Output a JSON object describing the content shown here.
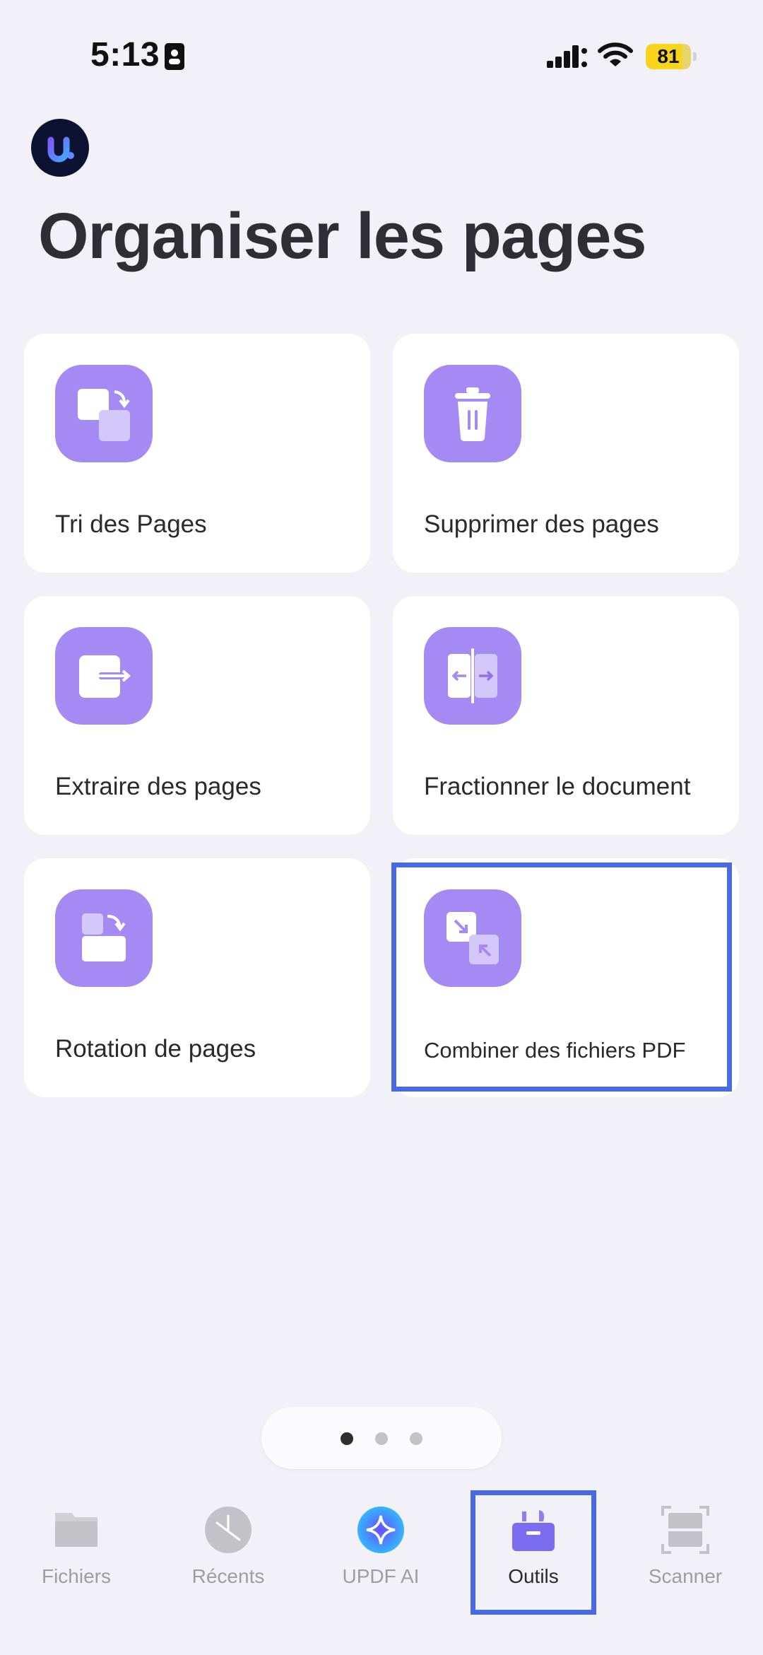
{
  "status_bar": {
    "time": "5:13",
    "battery_level": "81",
    "battery_fraction": 0.81
  },
  "app": {
    "logo_icon": "updf-logo-icon"
  },
  "page": {
    "title": "Organiser les pages"
  },
  "tools": [
    {
      "label": "Tri des Pages",
      "icon": "sort-pages-icon"
    },
    {
      "label": "Supprimer des pages",
      "icon": "trash-icon"
    },
    {
      "label": "Extraire des pages",
      "icon": "extract-pages-icon"
    },
    {
      "label": "Fractionner le document",
      "icon": "split-document-icon"
    },
    {
      "label": "Rotation de pages",
      "icon": "rotate-pages-icon"
    },
    {
      "label": "Combiner des fichiers PDF",
      "icon": "combine-pdf-icon"
    }
  ],
  "pager": {
    "count": 3,
    "active_index": 0
  },
  "tab_bar": {
    "items": [
      {
        "label": "Fichiers",
        "icon": "folder-icon"
      },
      {
        "label": "Récents",
        "icon": "clock-icon"
      },
      {
        "label": "UPDF AI",
        "icon": "ai-sparkle-icon"
      },
      {
        "label": "Outils",
        "icon": "toolbox-icon"
      },
      {
        "label": "Scanner",
        "icon": "scanner-icon"
      }
    ],
    "active": "Outils"
  },
  "colors": {
    "accent": "#a58af4",
    "highlight": "#4a6ae3",
    "background": "#f2f1f7"
  }
}
